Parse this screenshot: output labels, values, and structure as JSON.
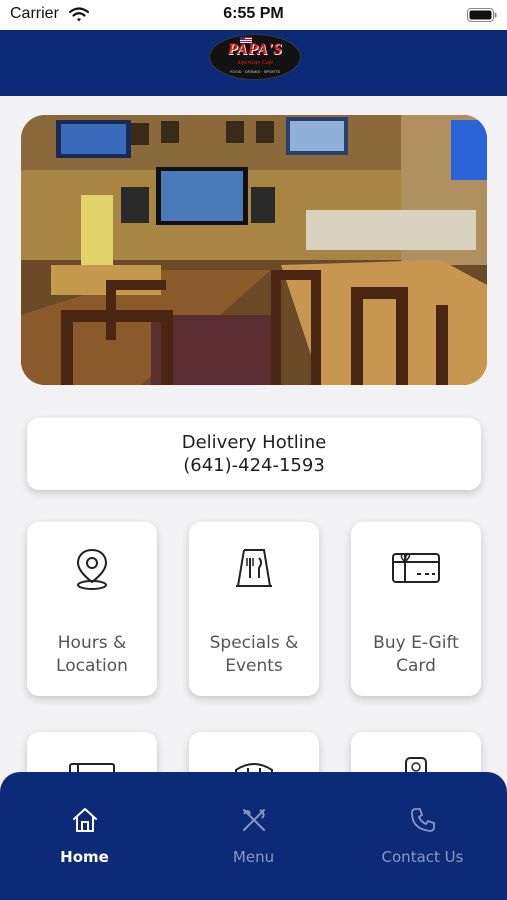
{
  "status_bar": {
    "carrier": "Carrier",
    "time": "6:55 PM"
  },
  "header": {
    "logo_main": "PAPA'S",
    "logo_sub": "American Cafe",
    "logo_tagline": "FOOD · DRINKS · SPORTS"
  },
  "hero": {
    "icon": "restaurant-interior-photo"
  },
  "hotline": {
    "label": "Delivery Hotline",
    "phone": "(641)-424-1593"
  },
  "tiles": [
    {
      "label": "Hours &\nLocation",
      "icon": "location-pin-icon"
    },
    {
      "label": "Specials &\nEvents",
      "icon": "specials-sign-icon"
    },
    {
      "label": "Buy E-Gift\nCard",
      "icon": "gift-card-icon"
    }
  ],
  "tabbar": {
    "items": [
      {
        "label": "Home",
        "icon": "home-icon",
        "active": true
      },
      {
        "label": "Menu",
        "icon": "utensils-icon",
        "active": false
      },
      {
        "label": "Contact Us",
        "icon": "phone-icon",
        "active": false
      }
    ]
  },
  "colors": {
    "brand_navy": "#0d2a78",
    "background": "#f2f2f4",
    "card": "#ffffff",
    "inactive_tab": "#8a98be"
  }
}
